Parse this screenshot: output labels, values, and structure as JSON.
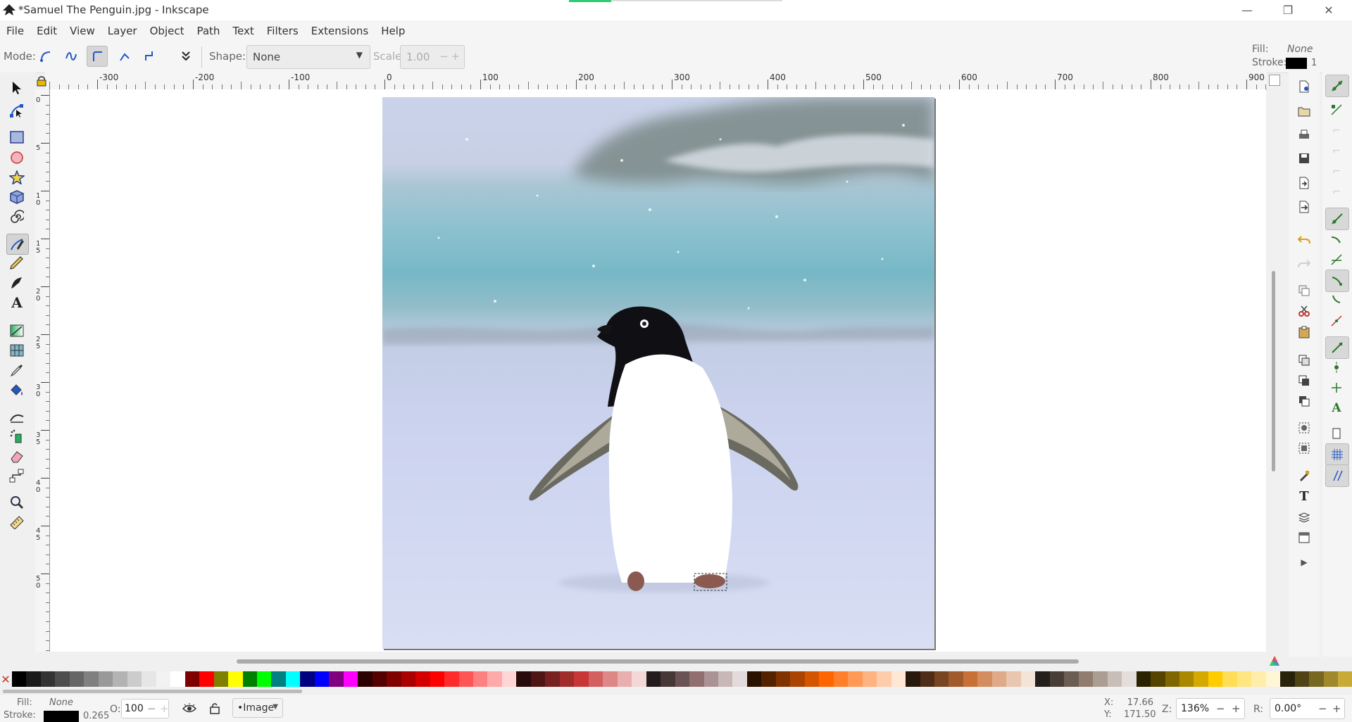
{
  "window": {
    "title": "*Samuel The Penguin.jpg - Inkscape",
    "controls": {
      "minimize": "—",
      "restore": "❐",
      "close": "✕"
    }
  },
  "menubar": [
    "File",
    "Edit",
    "View",
    "Layer",
    "Object",
    "Path",
    "Text",
    "Filters",
    "Extensions",
    "Help"
  ],
  "tool_controls": {
    "mode_label": "Mode:",
    "shape_label": "Shape:",
    "shape_value": "None",
    "scale_label": "Scale:",
    "scale_value": "1.00",
    "fill_label": "Fill:",
    "fill_value": "None",
    "stroke_label": "Stroke:",
    "stroke_width": "1",
    "stroke_color": "#000000",
    "mode_buttons": [
      "bezier-mode-icon",
      "spiro-mode-icon",
      "bspline-mode-icon",
      "straight-segments-icon",
      "paraxial-mode-icon"
    ],
    "active_mode": "bspline-mode-icon"
  },
  "ruler": {
    "labels": [
      "-300",
      "-200",
      "-100",
      "0",
      "100",
      "200",
      "300",
      "400",
      "500",
      "600",
      "700",
      "800",
      "900"
    ],
    "vertical_labels": [
      "0",
      "5",
      "1 0",
      "1 5",
      "2 0",
      "2 5",
      "3 0",
      "3 5",
      "4 0",
      "4 5",
      "5 0"
    ]
  },
  "tools": [
    "select-icon",
    "node-icon",
    "rectangle-icon",
    "ellipse-icon",
    "star-icon",
    "3dbox-icon",
    "spiral-icon",
    "pen-icon",
    "pencil-icon",
    "calligraphy-icon",
    "text-icon",
    "gradient-icon",
    "mesh-icon",
    "dropper-icon",
    "paint-bucket-icon",
    "tweak-icon",
    "spray-icon",
    "eraser-icon",
    "connector-icon",
    "zoom-icon",
    "measure-icon"
  ],
  "active_tool": "pen-icon",
  "palette": [
    "#000000",
    "#1a1a1a",
    "#333333",
    "#4d4d4d",
    "#666666",
    "#808080",
    "#999999",
    "#b3b3b3",
    "#cccccc",
    "#e6e6e6",
    "#f2f2f2",
    "#ffffff",
    "#800000",
    "#ff0000",
    "#808000",
    "#ffff00",
    "#008000",
    "#00ff00",
    "#008080",
    "#00ffff",
    "#000080",
    "#0000ff",
    "#800080",
    "#ff00ff",
    "#2b0000",
    "#550000",
    "#800000",
    "#aa0000",
    "#d40000",
    "#ff0000",
    "#ff2a2a",
    "#ff5555",
    "#ff8080",
    "#ffaaaa",
    "#ffd5d5",
    "#280b0b",
    "#501616",
    "#782121",
    "#a02c2c",
    "#c83737",
    "#d35f5f",
    "#de8787",
    "#e9afaf",
    "#f4d7d7",
    "#241c1c",
    "#483737",
    "#6c5353",
    "#916f6f",
    "#ac9393",
    "#c8b7b7",
    "#e3dbdb",
    "#2b1100",
    "#552200",
    "#803300",
    "#aa4400",
    "#d45500",
    "#ff6600",
    "#ff7f2a",
    "#ff9955",
    "#ffb380",
    "#ffccaa",
    "#ffe6d5",
    "#28170b",
    "#502d16",
    "#784421",
    "#a05a2c",
    "#c87137",
    "#d38d5f",
    "#deaa87",
    "#e9c6af",
    "#f4e3d7",
    "#241f1c",
    "#483e37",
    "#6c5d53",
    "#917c6f",
    "#ac9d93",
    "#c8beb7",
    "#e3dedb",
    "#2b2200",
    "#554400",
    "#806600",
    "#aa8800",
    "#d4aa00",
    "#ffcc00",
    "#ffdd55",
    "#ffe680",
    "#ffeeaa",
    "#fff6d5",
    "#28220b",
    "#504416",
    "#786721",
    "#a0892c",
    "#c8ab37"
  ],
  "status": {
    "fill_label": "Fill:",
    "fill_value": "None",
    "stroke_label": "Stroke:",
    "stroke_width": "0.265",
    "opacity_label": "O:",
    "opacity_value": "100",
    "layer": "•Image",
    "x_label": "X:",
    "x_value": "17.66",
    "y_label": "Y:",
    "y_value": "171.50",
    "zoom_label": "Z:",
    "zoom_value": "136%",
    "rotate_label": "R:",
    "rotate_value": "0.00°"
  },
  "colors": {
    "accent": "#2457c5",
    "sky": "#cfd6ef",
    "water": "#79b9c6",
    "snow": "#d9def1"
  }
}
